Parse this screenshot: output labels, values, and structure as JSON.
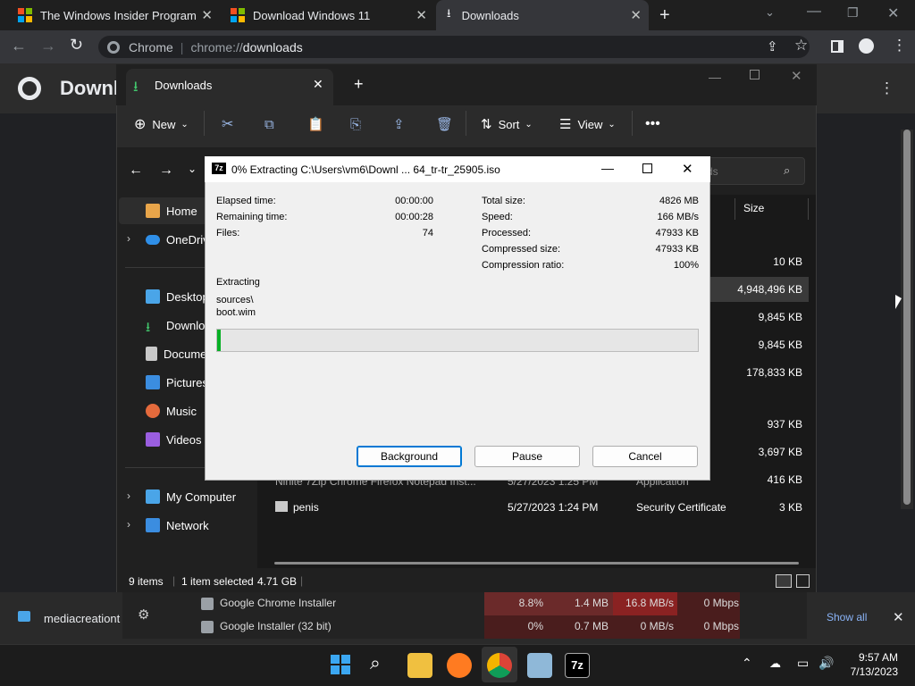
{
  "browser": {
    "tabs": [
      {
        "label": "The Windows Insider Program"
      },
      {
        "label": "Download Windows 11"
      },
      {
        "label": "Downloads"
      }
    ],
    "omnibox": {
      "scheme_label": "Chrome",
      "url_prefix": "chrome://",
      "url_path": "downloads"
    },
    "page_title": "Downl"
  },
  "explorer": {
    "tab_title": "Downloads",
    "commands": {
      "new": "New",
      "sort": "Sort",
      "view": "View"
    },
    "search_placeholder": "ds",
    "column_size": "Size",
    "nav": [
      {
        "label": "Home",
        "icon": "home-icon"
      },
      {
        "label": "OneDriv",
        "icon": "cloud-icon"
      },
      {
        "label": "Desktop",
        "icon": "desktop-icon"
      },
      {
        "label": "Downloa",
        "icon": "download-icon"
      },
      {
        "label": "Docume",
        "icon": "document-icon"
      },
      {
        "label": "Pictures",
        "icon": "pictures-icon"
      },
      {
        "label": "Music",
        "icon": "music-icon"
      },
      {
        "label": "Videos",
        "icon": "videos-icon"
      },
      {
        "label": "My Computer",
        "icon": "computer-icon"
      },
      {
        "label": "Network",
        "icon": "network-icon"
      }
    ],
    "sizes": [
      "10 KB",
      "4,948,496 KB",
      "9,845 KB",
      "9,845 KB",
      "178,833 KB",
      "937 KB",
      "3,697 KB",
      "416 KB",
      "3 KB"
    ],
    "partial_row": {
      "name": "Ninite 7Zip Chrome Firefox Notepad Inst...",
      "date": "5/27/2023 1:25 PM",
      "type": "Application"
    },
    "last_row": {
      "name": "penis",
      "date": "5/27/2023 1:24 PM",
      "type": "Security Certificate",
      "size": "3 KB"
    },
    "status": {
      "items": "9 items",
      "selected": "1 item selected",
      "sel_size": "4.71 GB"
    }
  },
  "zip": {
    "title": "0% Extracting C:\\Users\\vm6\\Downl ... 64_tr-tr_25905.iso",
    "left": [
      {
        "label": "Elapsed time:",
        "value": "00:00:00"
      },
      {
        "label": "Remaining time:",
        "value": "00:00:28"
      },
      {
        "label": "Files:",
        "value": "74"
      }
    ],
    "right": [
      {
        "label": "Total size:",
        "value": "4826 MB"
      },
      {
        "label": "Speed:",
        "value": "166 MB/s"
      },
      {
        "label": "Processed:",
        "value": "47933 KB"
      },
      {
        "label": "Compressed size:",
        "value": "47933 KB"
      },
      {
        "label": "Compression ratio:",
        "value": "100%"
      }
    ],
    "action": "Extracting",
    "path1": "sources\\",
    "path2": "boot.wim",
    "progress_fraction": 0.0,
    "buttons": {
      "background": "Background",
      "pause": "Pause",
      "cancel": "Cancel"
    }
  },
  "shelf": {
    "download_item": "mediacreationt",
    "show_all": "Show all"
  },
  "taskmgr": {
    "rows": [
      {
        "name": "Google Chrome Installer",
        "cpu": "8.8%",
        "mem": "1.4 MB",
        "disk": "16.8 MB/s",
        "net": "0 Mbps"
      },
      {
        "name": "Google Installer (32 bit)",
        "cpu": "0%",
        "mem": "0.7 MB",
        "disk": "0 MB/s",
        "net": "0 Mbps"
      }
    ]
  },
  "taskbar": {
    "time": "9:57 AM",
    "date": "7/13/2023"
  }
}
